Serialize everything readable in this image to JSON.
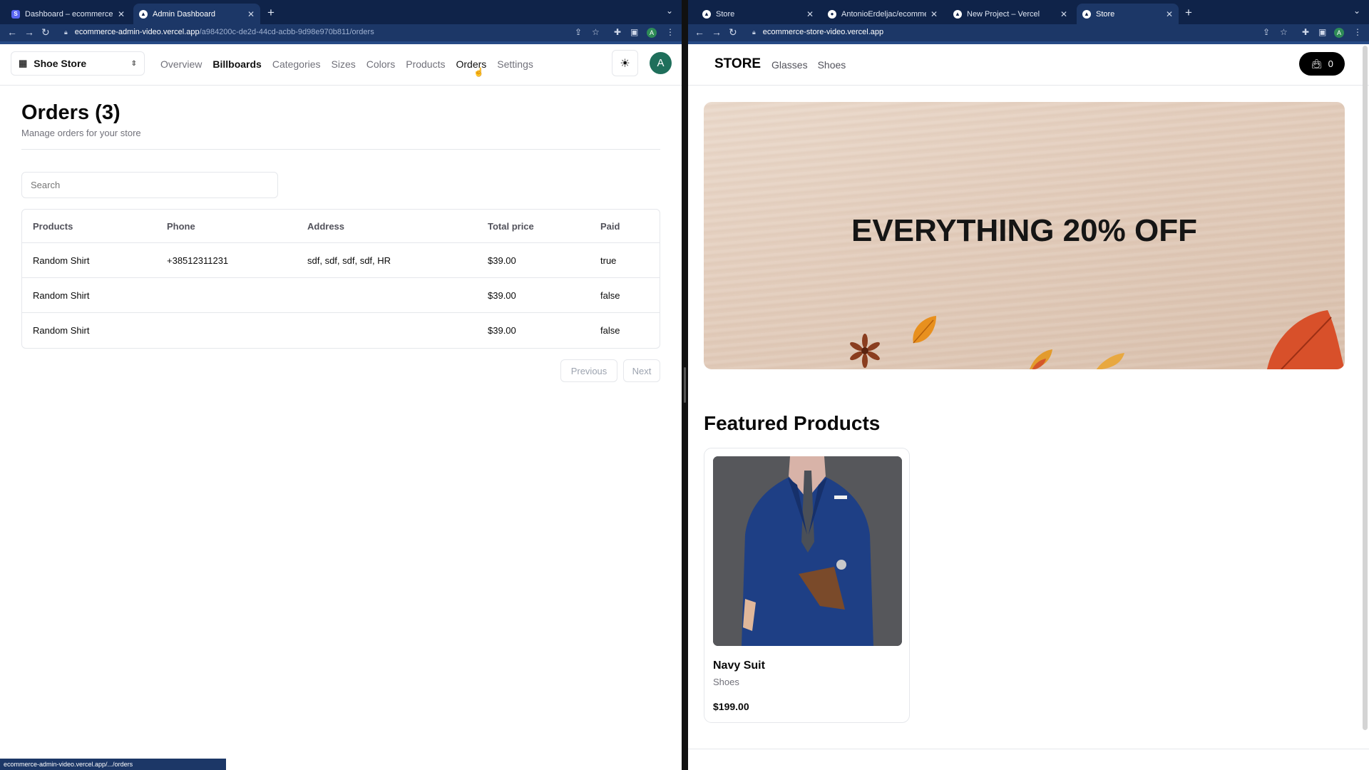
{
  "left": {
    "tabs": [
      {
        "title": "Dashboard – ecommerce-adm",
        "favicon": "S",
        "active": false
      },
      {
        "title": "Admin Dashboard",
        "favicon": "▲",
        "active": true
      }
    ],
    "url_domain": "ecommerce-admin-video.vercel.app",
    "url_path": "/a984200c-de2d-44cd-acbb-9d98e970b811/orders",
    "profile_initial": "A",
    "store_switcher": "Shoe Store",
    "nav": [
      "Overview",
      "Billboards",
      "Categories",
      "Sizes",
      "Colors",
      "Products",
      "Orders",
      "Settings"
    ],
    "avatar_initial": "A",
    "title": "Orders (3)",
    "subtitle": "Manage orders for your store",
    "search_placeholder": "Search",
    "table": {
      "headers": [
        "Products",
        "Phone",
        "Address",
        "Total price",
        "Paid"
      ],
      "rows": [
        [
          "Random Shirt",
          "+38512311231",
          "sdf, sdf, sdf, sdf, HR",
          "$39.00",
          "true"
        ],
        [
          "Random Shirt",
          "",
          "",
          "$39.00",
          "false"
        ],
        [
          "Random Shirt",
          "",
          "",
          "$39.00",
          "false"
        ]
      ]
    },
    "pager": {
      "previous": "Previous",
      "next": "Next"
    },
    "status_url": "ecommerce-admin-video.vercel.app/.../orders"
  },
  "right": {
    "tabs": [
      {
        "title": "Store",
        "favicon": "▲",
        "active": false
      },
      {
        "title": "AntonioErdeljac/ecommerce-s",
        "favicon": "●",
        "active": false
      },
      {
        "title": "New Project – Vercel",
        "favicon": "▲",
        "active": false
      },
      {
        "title": "Store",
        "favicon": "▲",
        "active": true
      }
    ],
    "url": "ecommerce-store-video.vercel.app",
    "profile_initial": "A",
    "logo": "STORE",
    "nav": [
      "Glasses",
      "Shoes"
    ],
    "cart_count": "0",
    "billboard_text": "EVERYTHING 20% OFF",
    "featured_title": "Featured Products",
    "product": {
      "name": "Navy Suit",
      "category": "Shoes",
      "price": "$199.00"
    }
  },
  "colors": {
    "tab_bar": "#0f2349",
    "toolbar": "#1c3767",
    "avatar": "#1f6f5b",
    "accent": "#000000"
  }
}
